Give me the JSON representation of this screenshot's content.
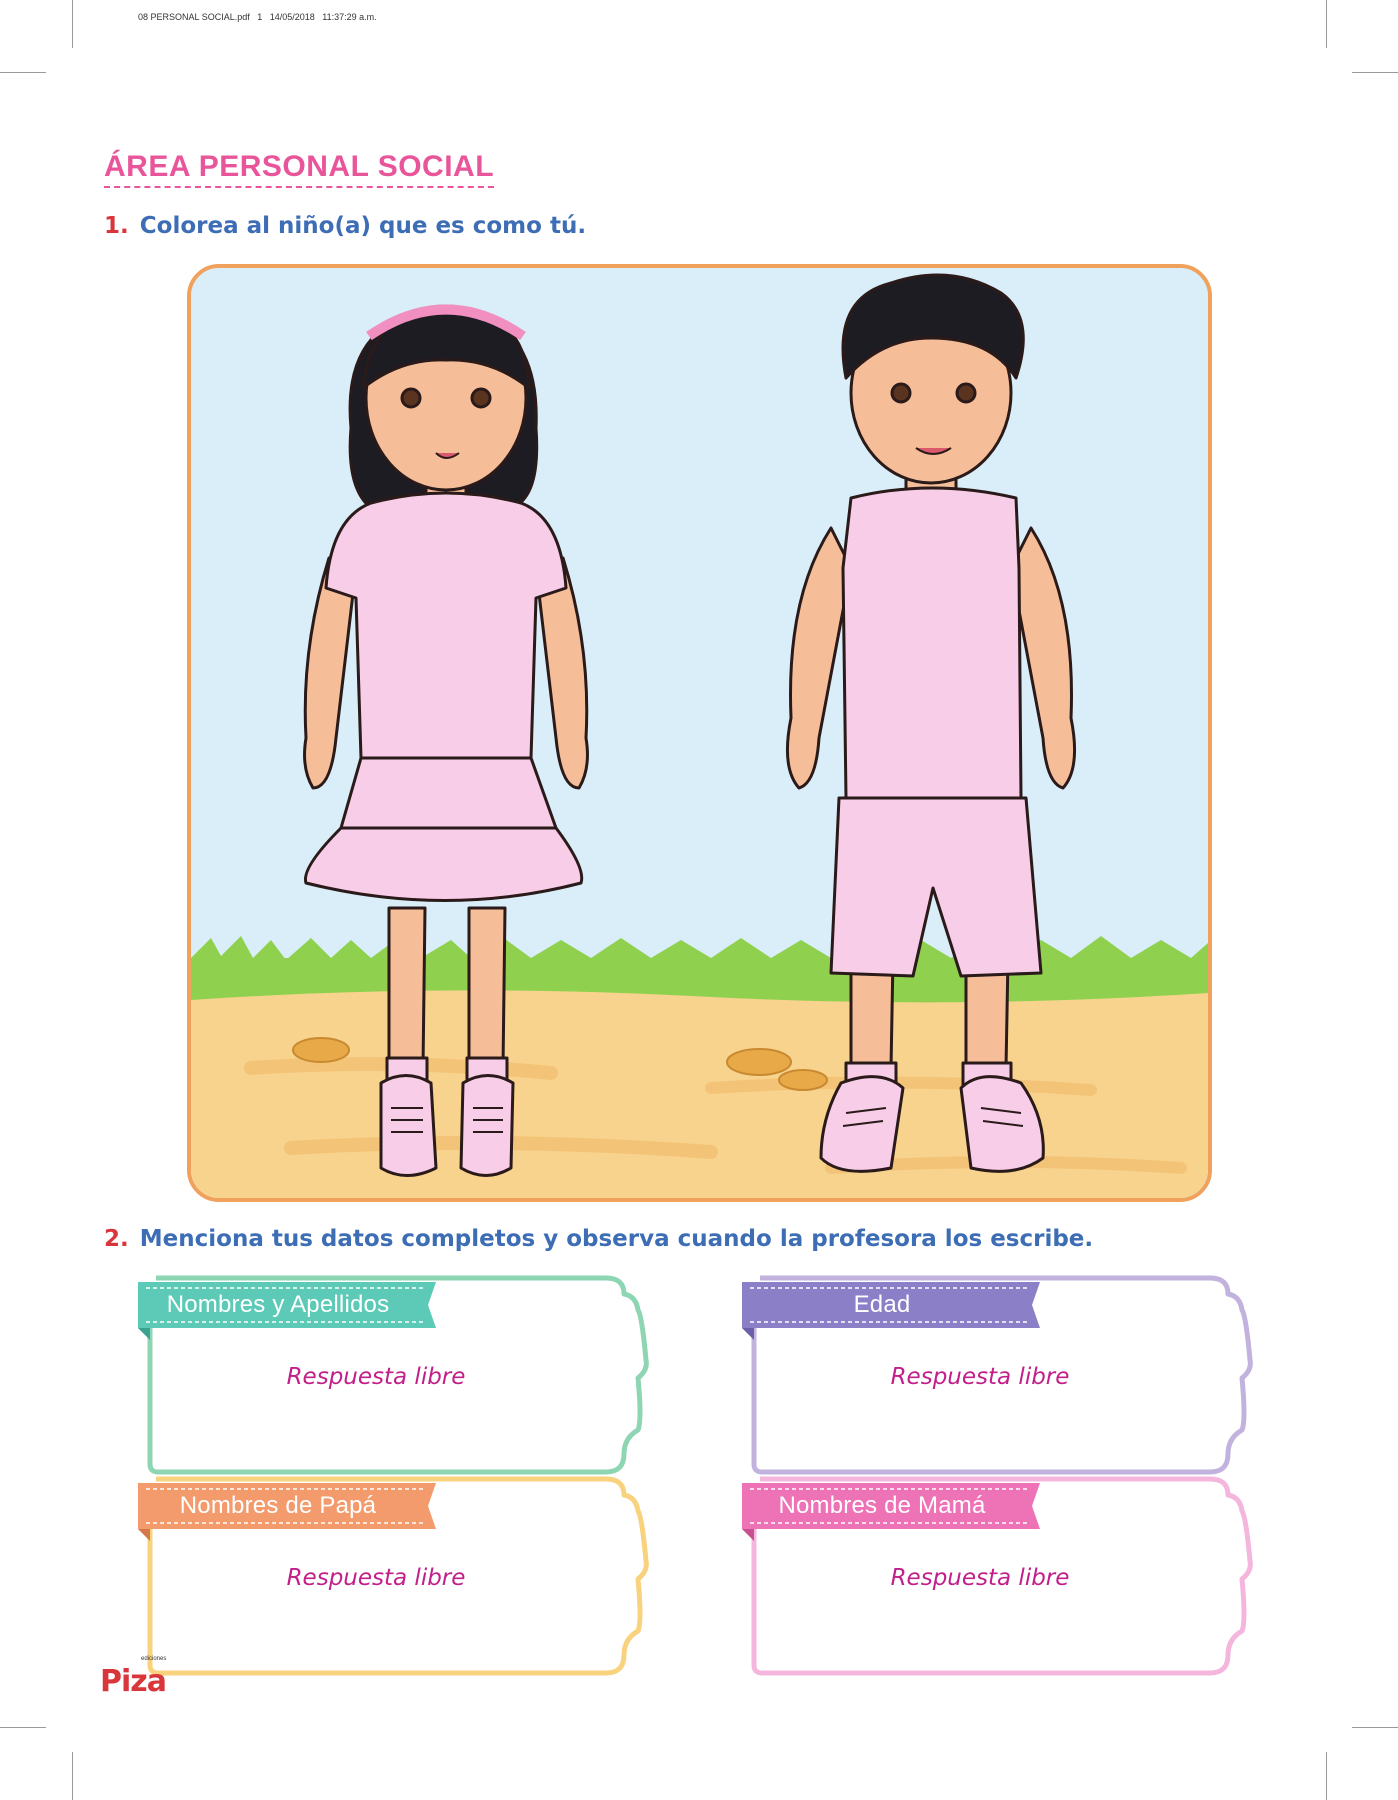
{
  "file_header": "08 PERSONAL SOCIAL.pdf   1   14/05/2018   11:37:29 a.m.",
  "section_title": "ÁREA PERSONAL SOCIAL",
  "question1": {
    "number": "1.",
    "text": "Colorea al niño(a) que es como tú."
  },
  "question2": {
    "number": "2.",
    "text": "Menciona tus datos completos y observa cuando la profesora los escribe."
  },
  "cards": [
    {
      "title": "Nombres y Apellidos",
      "answer": "Respuesta libre",
      "tab_color": "#5ccab6",
      "border_color": "#8ed5b3"
    },
    {
      "title": "Edad",
      "answer": "Respuesta libre",
      "tab_color": "#8b7fc8",
      "border_color": "#c1b2de"
    },
    {
      "title": "Nombres de Papá",
      "answer": "Respuesta libre",
      "tab_color": "#f39b6d",
      "border_color": "#f8d27c"
    },
    {
      "title": "Nombres de Mamá",
      "answer": "Respuesta libre",
      "tab_color": "#ee72b6",
      "border_color": "#f4b6dc"
    }
  ],
  "publisher": {
    "small_text": "ediciones",
    "name": "Piza"
  },
  "colors": {
    "title_pink": "#e9559a",
    "question_blue": "#3c6db5",
    "number_red": "#d8363b",
    "answer_magenta": "#c21f8a",
    "clothes_pink": "#f8cde8"
  }
}
